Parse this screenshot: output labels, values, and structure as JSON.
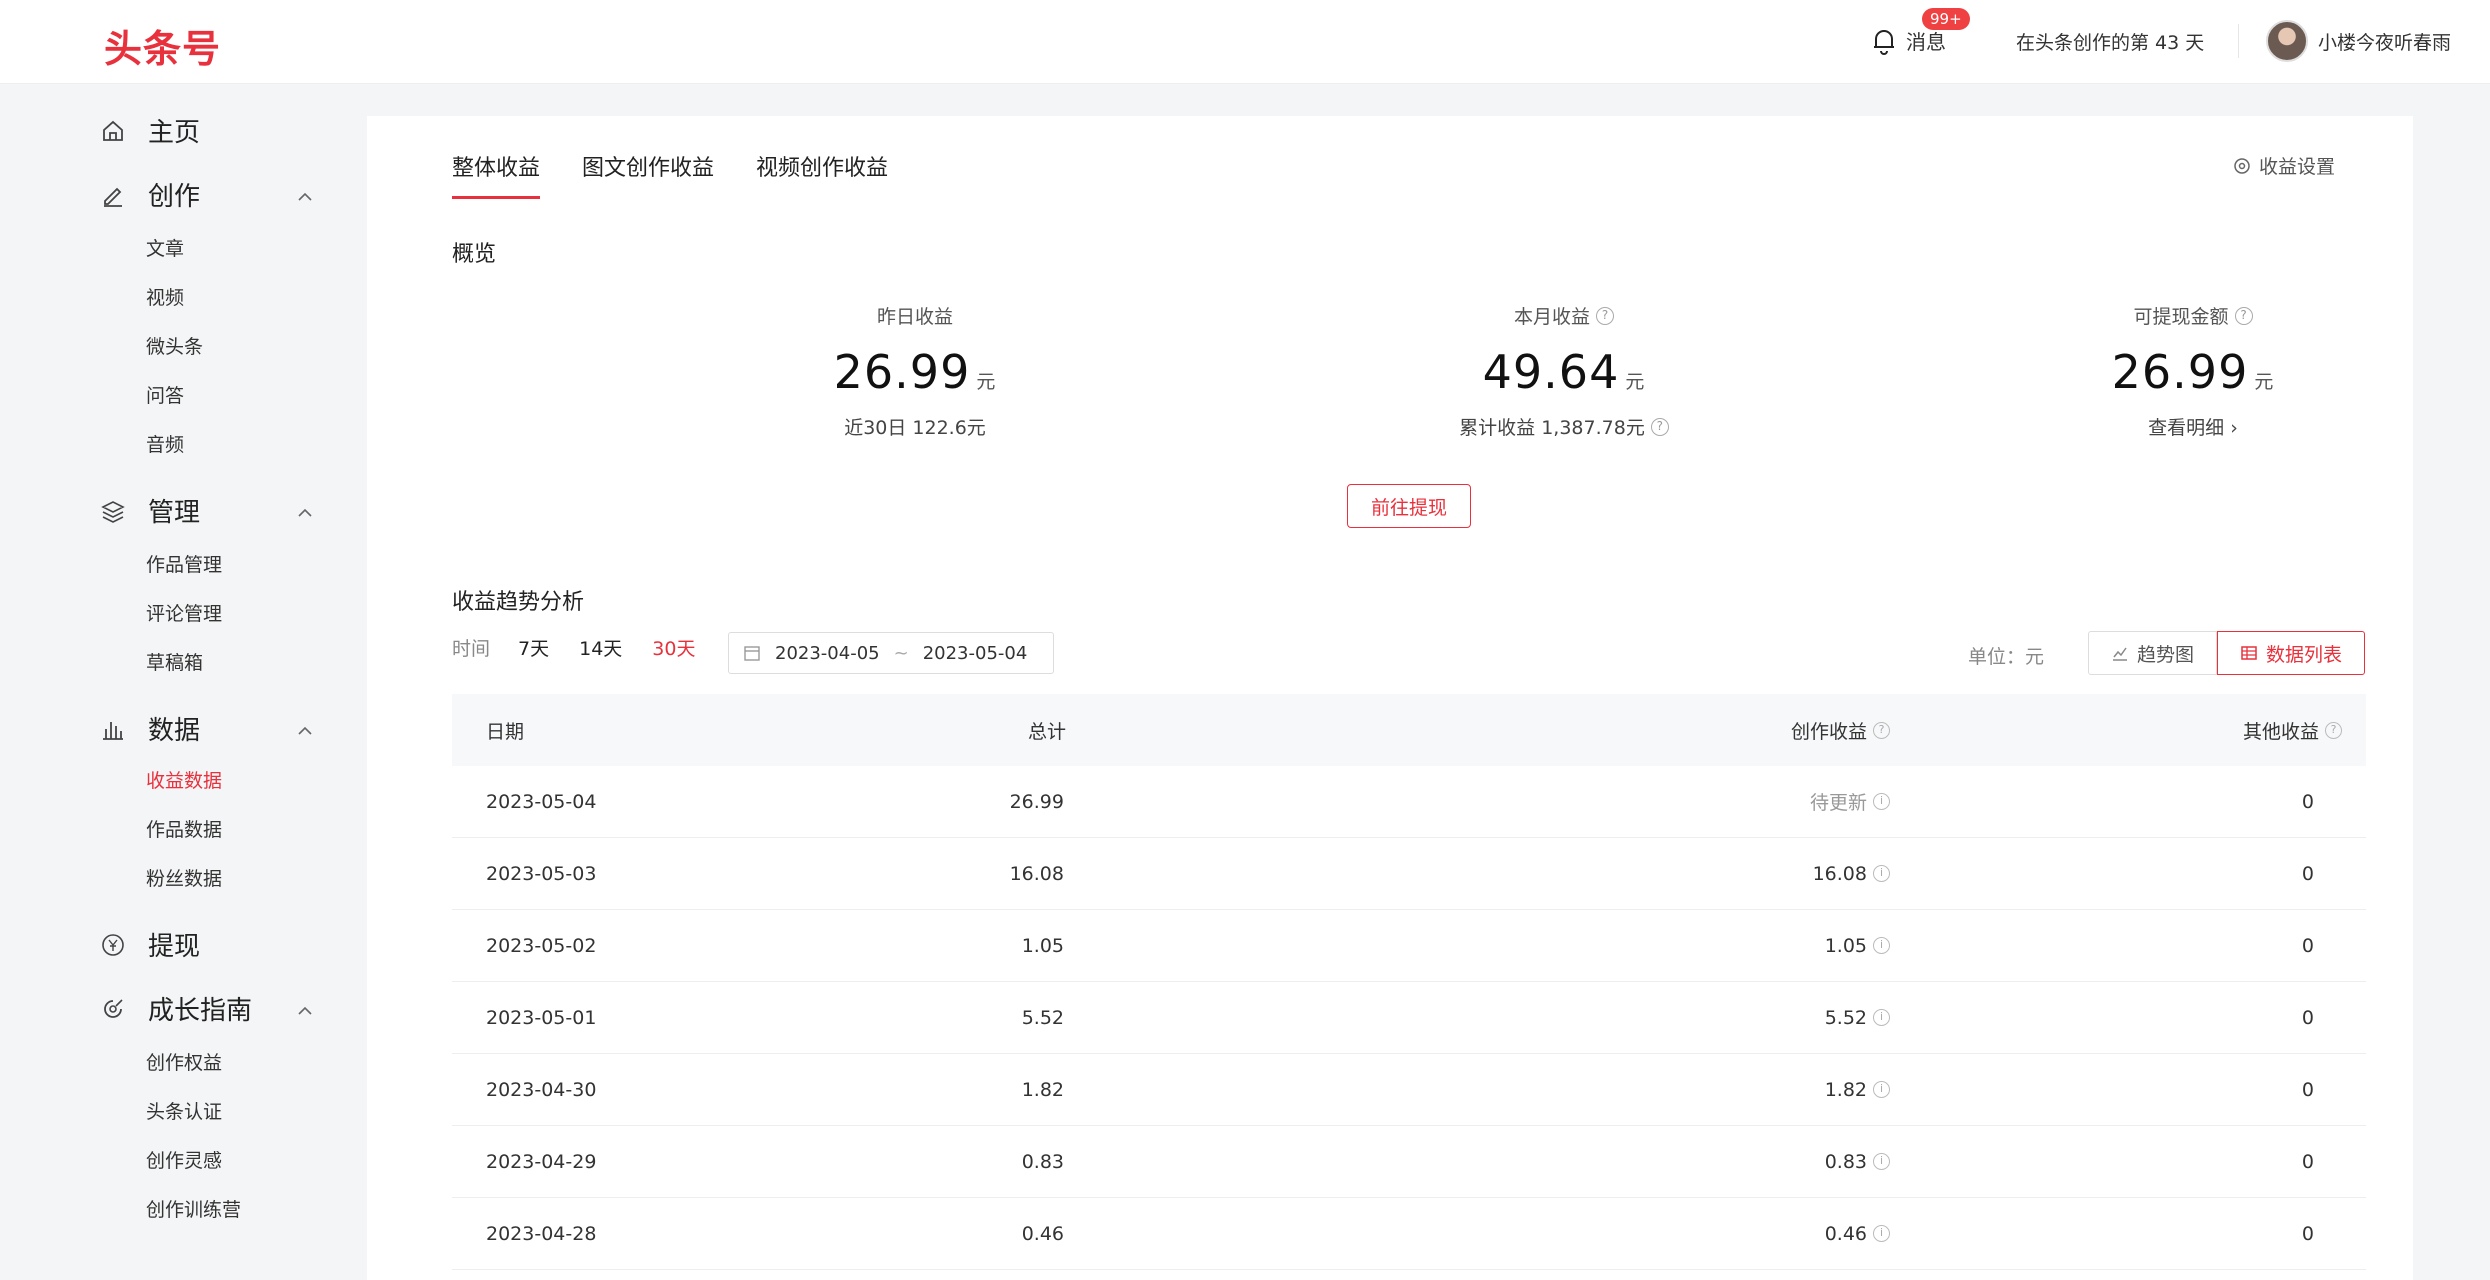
{
  "header": {
    "logo": "头条号",
    "messages_label": "消息",
    "messages_badge": "99+",
    "creation_days": "在头条创作的第 43 天",
    "username": "小楼今夜听春雨"
  },
  "sidebar": {
    "groups": [
      {
        "label": "主页",
        "icon": "home-icon"
      },
      {
        "label": "创作",
        "icon": "pen-icon",
        "items": [
          "文章",
          "视频",
          "微头条",
          "问答",
          "音频"
        ]
      },
      {
        "label": "管理",
        "icon": "layers-icon",
        "items": [
          "作品管理",
          "评论管理",
          "草稿箱"
        ]
      },
      {
        "label": "数据",
        "icon": "bar-chart-icon",
        "items": [
          "收益数据",
          "作品数据",
          "粉丝数据"
        ]
      },
      {
        "label": "提现",
        "icon": "yen-circle-icon"
      },
      {
        "label": "成长指南",
        "icon": "growth-icon",
        "items": [
          "创作权益",
          "头条认证",
          "创作灵感",
          "创作训练营"
        ]
      }
    ],
    "active_item": "收益数据"
  },
  "tabs": [
    "整体收益",
    "图文创作收益",
    "视频创作收益"
  ],
  "settings_label": "收益设置",
  "overview": {
    "title": "概览",
    "stats": [
      {
        "label": "昨日收益",
        "value": "26.99",
        "unit": "元",
        "sub": "近30日 122.6元"
      },
      {
        "label": "本月收益",
        "value": "49.64",
        "unit": "元",
        "sub": "累计收益 1,387.78元"
      },
      {
        "label": "可提现金额",
        "value": "26.99",
        "unit": "元",
        "sub": "查看明细 ›"
      }
    ],
    "withdraw_button": "前往提现"
  },
  "trend": {
    "title": "收益趋势分析",
    "time_label": "时间",
    "options": [
      "7天",
      "14天",
      "30天"
    ],
    "active_option": "30天",
    "date_start": "2023-04-05",
    "date_sep": "~",
    "date_end": "2023-05-04",
    "unit_label": "单位：元",
    "view_chart": "趋势图",
    "view_table": "数据列表"
  },
  "table": {
    "headers": [
      "日期",
      "总计",
      "创作收益",
      "其他收益"
    ],
    "rows": [
      [
        "2023-05-04",
        "26.99",
        "待更新",
        "0"
      ],
      [
        "2023-05-03",
        "16.08",
        "16.08",
        "0"
      ],
      [
        "2023-05-02",
        "1.05",
        "1.05",
        "0"
      ],
      [
        "2023-05-01",
        "5.52",
        "5.52",
        "0"
      ],
      [
        "2023-04-30",
        "1.82",
        "1.82",
        "0"
      ],
      [
        "2023-04-29",
        "0.83",
        "0.83",
        "0"
      ],
      [
        "2023-04-28",
        "0.46",
        "0.46",
        "0"
      ]
    ]
  }
}
